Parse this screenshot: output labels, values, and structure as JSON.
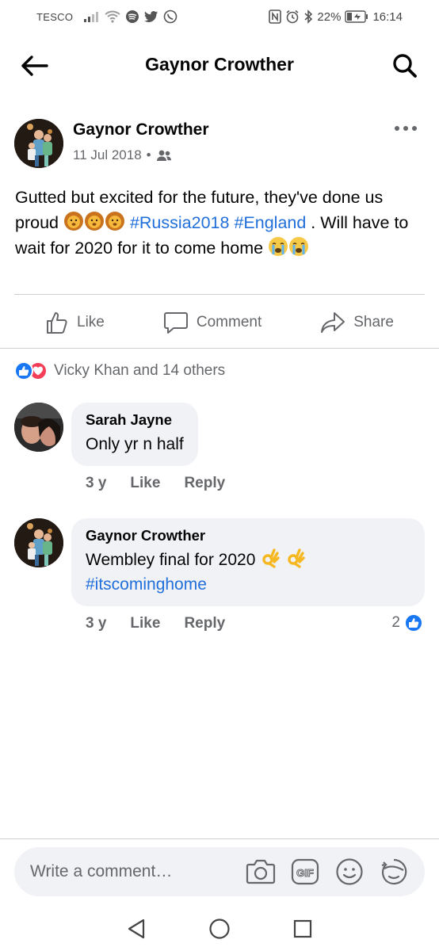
{
  "status_bar": {
    "carrier": "TESCO",
    "battery_percent": "22%",
    "time": "16:14"
  },
  "header": {
    "title": "Gaynor Crowther"
  },
  "post": {
    "author": "Gaynor Crowther",
    "date": "11 Jul 2018",
    "separator": "•",
    "text_part1": "Gutted but excited for the future, they've done us proud ",
    "hashtag1": "#Russia2018",
    "hashtag2": "#England",
    "text_part2": " . Will have to wait for 2020 for it to come home",
    "actions": {
      "like": "Like",
      "comment": "Comment",
      "share": "Share"
    },
    "reactions_summary": "Vicky Khan and 14 others"
  },
  "comments": [
    {
      "author": "Sarah Jayne",
      "text": "Only yr n half",
      "time": "3 y",
      "like": "Like",
      "reply": "Reply"
    },
    {
      "author": "Gaynor Crowther",
      "text": "Wembley final for 2020",
      "hashtag": "#itscominghome",
      "time": "3 y",
      "like": "Like",
      "reply": "Reply",
      "reaction_count": "2"
    }
  ],
  "composer": {
    "placeholder": "Write a comment…",
    "gif_label": "GIF"
  },
  "colors": {
    "accent": "#1877f2",
    "hashtag": "#216fdb",
    "secondary_text": "#65676b",
    "bubble": "#f0f2f5",
    "love": "#f33e58"
  }
}
